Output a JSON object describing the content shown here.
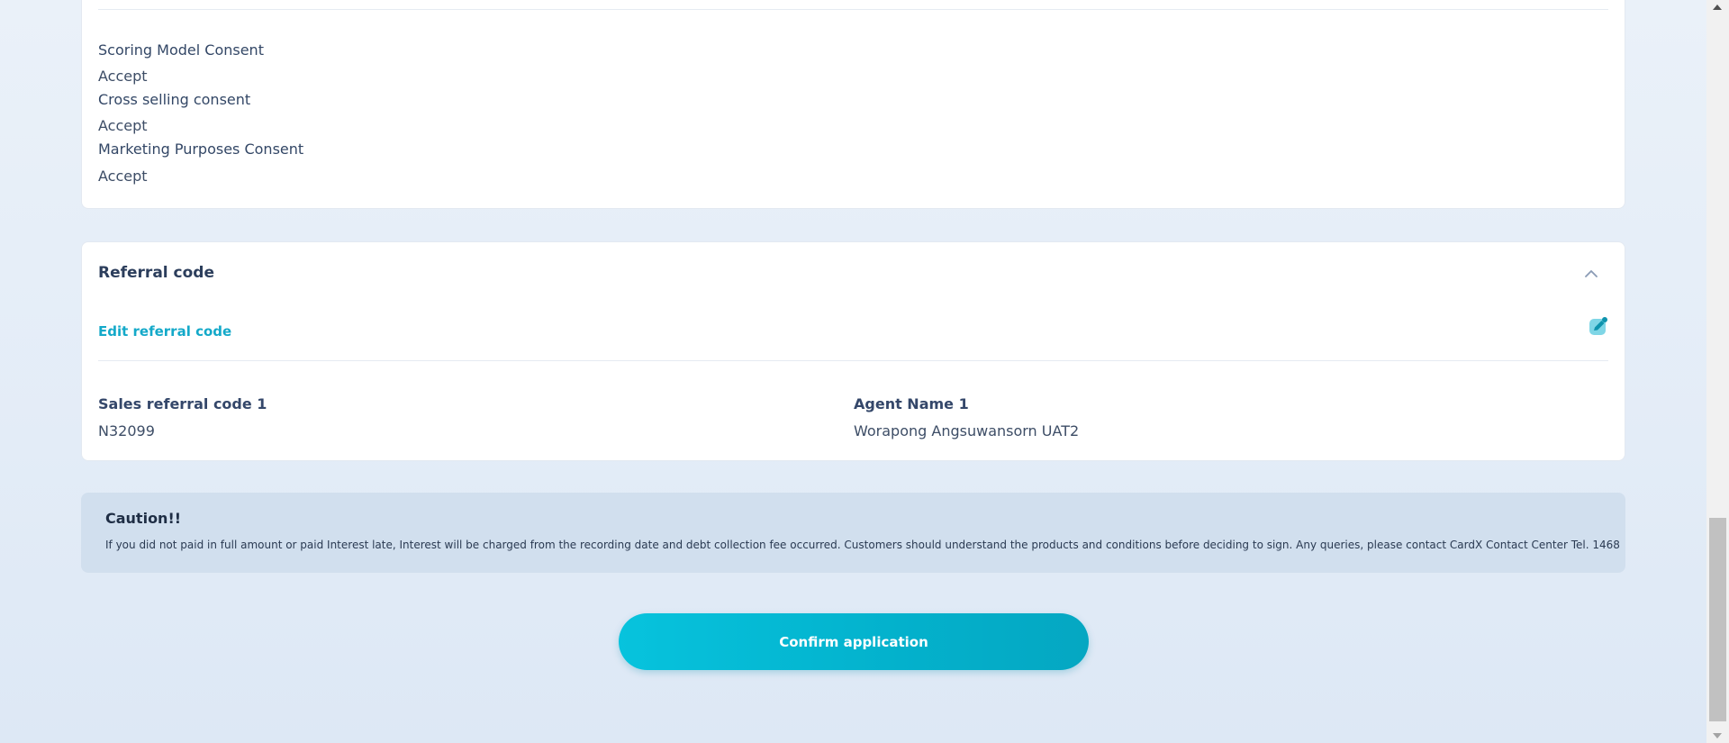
{
  "consents": [
    {
      "label": "Scoring Model Consent",
      "value": "Accept"
    },
    {
      "label": "Cross selling consent",
      "value": "Accept"
    },
    {
      "label": "Marketing Purposes Consent",
      "value": "Accept"
    }
  ],
  "referral": {
    "title": "Referral code",
    "edit_label": "Edit referral code",
    "sales_code_label": "Sales referral code 1",
    "sales_code_value": "N32099",
    "agent_name_label": "Agent Name 1",
    "agent_name_value": "Worapong Angsuwansorn UAT2",
    "chevron_icon": "chevron-up-icon",
    "edit_icon": "edit-pencil-icon"
  },
  "caution": {
    "title": "Caution!!",
    "text": "If you did not paid in full amount or paid Interest late, Interest will be charged from the recording date and debt collection fee occurred. Customers should understand the products and conditions before deciding to sign. Any queries, please contact CardX Contact Center Tel. 1468"
  },
  "actions": {
    "confirm_label": "Confirm application"
  },
  "colors": {
    "accent": "#14a9c9",
    "button": "#06b9d4",
    "caution_bg": "#d1dfee"
  }
}
